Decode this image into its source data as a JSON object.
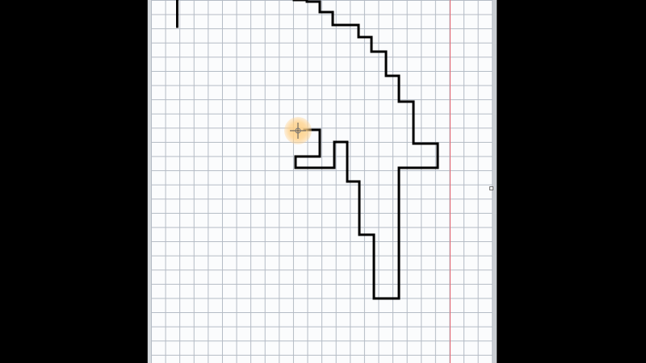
{
  "window": {
    "background": "#000000",
    "paper_color": "#fbfcfd",
    "grid_line_color": "#b3bac4",
    "margin_line_color": "#e26d78"
  },
  "canvas": {
    "tool_cursor_icon": "crosshair-icon",
    "cursor_highlight_color": "#ffcf84",
    "stroke_color": "#000000",
    "drawn_shape": "stepped-outline"
  },
  "scrollbar": {
    "resize_handle_icon": "resize-handle-icon"
  }
}
